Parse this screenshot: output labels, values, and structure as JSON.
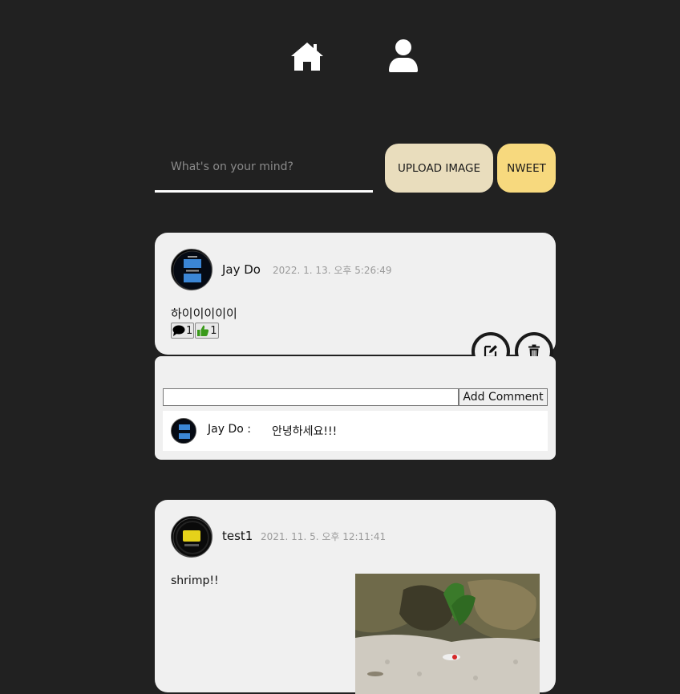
{
  "composer": {
    "placeholder": "What's on your mind?",
    "upload_label": "UPLOAD IMAGE",
    "submit_label": "NWEET"
  },
  "nweets": [
    {
      "author": "Jay Do",
      "timestamp": "2022. 1. 13. 오후 5:26:49",
      "text": "하이이이이이",
      "comment_count": "1",
      "like_count": "1"
    },
    {
      "author": "test1",
      "timestamp": "2021. 11. 5. 오후 12:11:41",
      "text": "shrimp!!"
    }
  ],
  "comments_panel": {
    "add_label": "Add Comment",
    "items": [
      {
        "author": "Jay Do :",
        "text": "안녕하세요!!!"
      }
    ]
  },
  "colors": {
    "background": "#212121",
    "card": "#f0f0f0",
    "upload": "#e9ddbd",
    "nweet": "#f7d97e",
    "like": "#3a9a1a"
  }
}
